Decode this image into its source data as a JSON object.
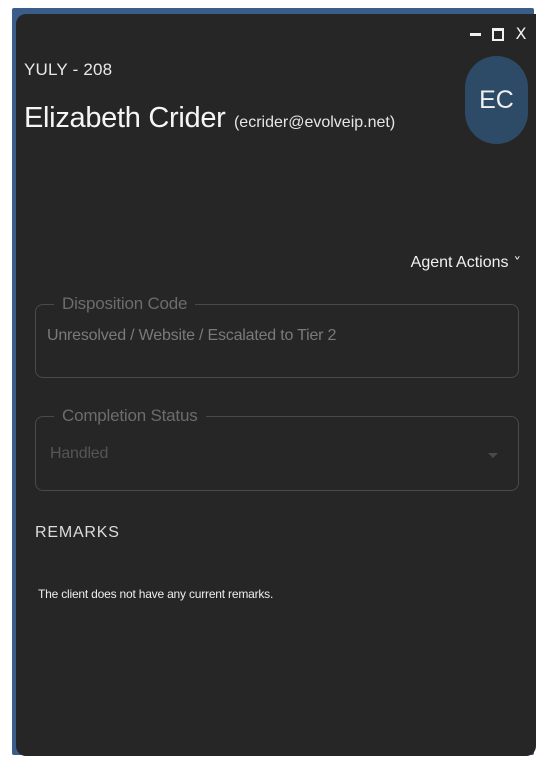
{
  "window": {
    "controls": [
      "minimize-icon",
      "maximize-icon",
      "close-icon"
    ],
    "close_glyph": "X"
  },
  "contact": {
    "extension": "YULY - 208",
    "name": "Elizabeth Crider",
    "email": "(ecrider@evolveip.net)",
    "avatar_initials": "EC",
    "avatar_color": "#2d4a67"
  },
  "agent_actions": {
    "label": "Agent Actions",
    "icon": "chevron-down-icon"
  },
  "disposition": {
    "label": "Disposition Code",
    "value": "Unresolved / Website / Escalated to Tier 2"
  },
  "completion": {
    "label": "Completion Status",
    "value": "Handled"
  },
  "remarks": {
    "title": "REMARKS",
    "text": "The client does not have any current remarks."
  },
  "colors": {
    "panel_bg": "#262626",
    "frame_accent": "#3a5d8a"
  }
}
